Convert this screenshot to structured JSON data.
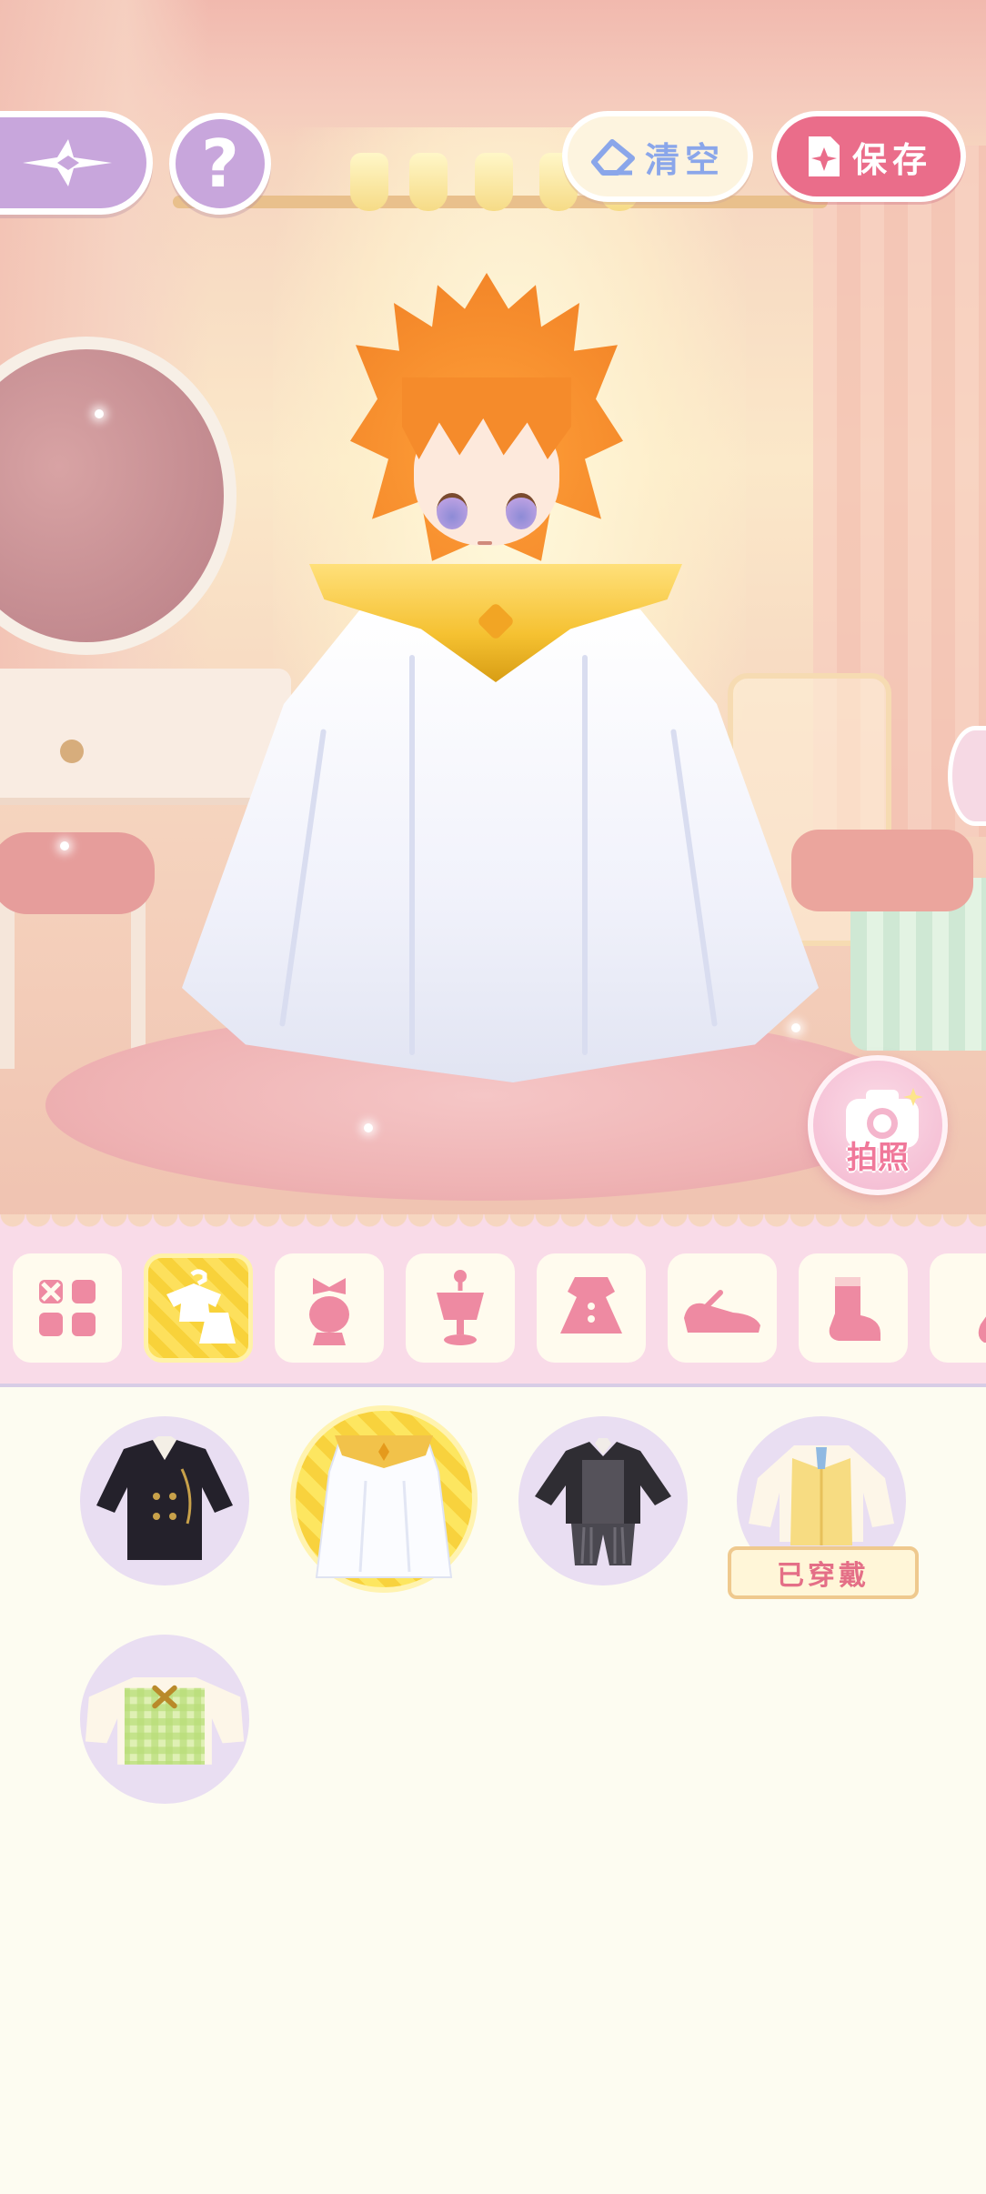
{
  "toolbar": {
    "clear_label": "清空",
    "save_label": "保存"
  },
  "photo": {
    "label": "拍照"
  },
  "categories": [
    {
      "name": "all",
      "icon": "grid-icon",
      "active": false
    },
    {
      "name": "outfit",
      "icon": "outfit-icon",
      "active": true
    },
    {
      "name": "hair",
      "icon": "hair-icon",
      "active": false
    },
    {
      "name": "top",
      "icon": "top-icon",
      "active": false
    },
    {
      "name": "dress",
      "icon": "dress-icon",
      "active": false
    },
    {
      "name": "shoes",
      "icon": "shoes-icon",
      "active": false
    },
    {
      "name": "socks",
      "icon": "socks-icon",
      "active": false
    },
    {
      "name": "more",
      "icon": "partial-icon",
      "active": false
    }
  ],
  "items": [
    {
      "name": "black-coat-outfit",
      "selected": false,
      "worn": false
    },
    {
      "name": "white-cape-outfit",
      "selected": true,
      "worn": false
    },
    {
      "name": "gray-suit-outfit",
      "selected": false,
      "worn": false
    },
    {
      "name": "yellow-vest-outfit",
      "selected": false,
      "worn": true
    },
    {
      "name": "green-plaid-top",
      "selected": false,
      "worn": false
    }
  ],
  "worn_label": "已穿戴",
  "colors": {
    "accent_pink": "#ea6d8a",
    "accent_purple": "#c8a6dc",
    "accent_yellow": "#f8d23a",
    "clear_text": "#8aa6ea"
  }
}
